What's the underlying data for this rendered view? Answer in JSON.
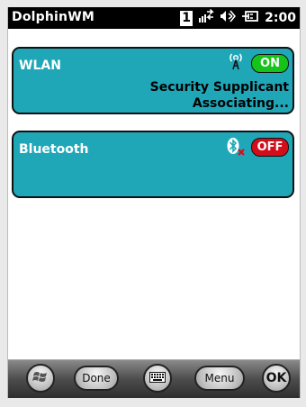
{
  "status_bar": {
    "app_title": "DolphinWM",
    "badge": "1",
    "time": "2:00",
    "icons": [
      "signal-arrows-icon",
      "speaker-icon",
      "battery-plug-icon"
    ]
  },
  "wlan": {
    "name": "WLAN",
    "toggle_label": "ON",
    "status_line1": "Security Supplicant",
    "status_line2": "Associating...",
    "icon": "wifi-antenna-icon"
  },
  "bluetooth": {
    "name": "Bluetooth",
    "toggle_label": "OFF",
    "icon": "bluetooth-disabled-icon"
  },
  "toolbar": {
    "done_label": "Done",
    "menu_label": "Menu",
    "ok_label": "OK"
  },
  "colors": {
    "card_bg": "#1fa7b8",
    "on": "#16c31a",
    "off": "#d40d1b"
  }
}
